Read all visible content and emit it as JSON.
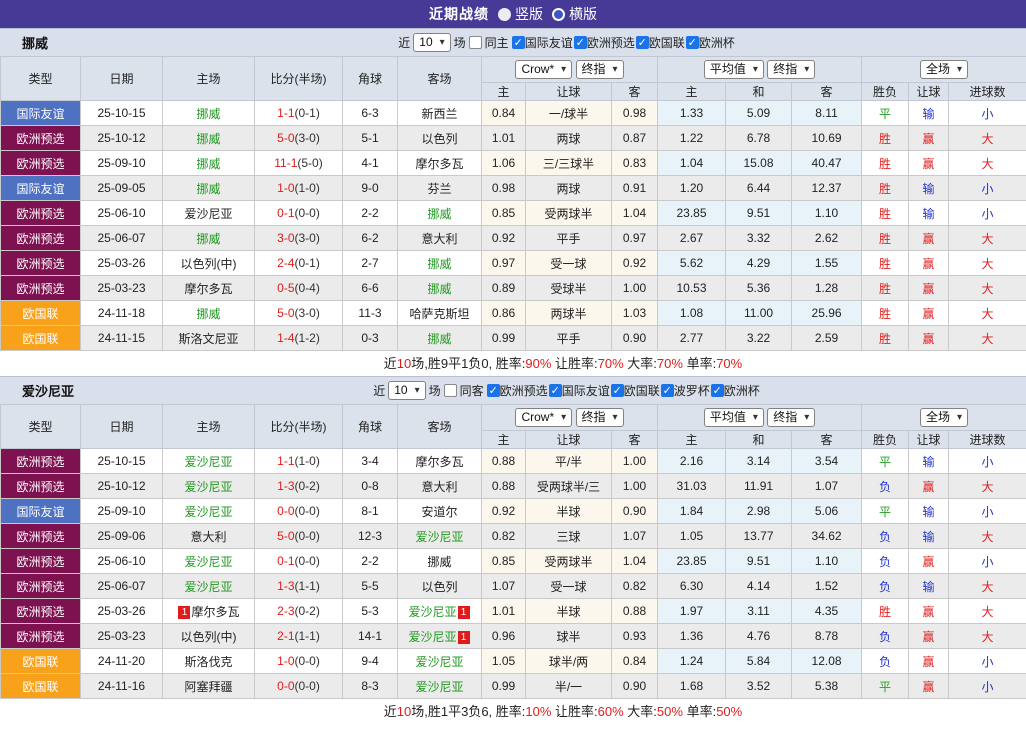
{
  "titlebar": {
    "title": "近期战绩",
    "radios": [
      {
        "label": "竖版",
        "selected": true
      },
      {
        "label": "横版",
        "selected": false
      }
    ]
  },
  "icons": {
    "check": "✓",
    "select_arrow": "▾"
  },
  "colors": {
    "accent_purple": "#473a97",
    "section_header_bg": "#d9dfeb",
    "table_header_bg": "#dce2ec",
    "row_alt_bg": "#ebebeb",
    "odds_group1_bg": "#fcf7ec",
    "odds_group2_bg": "#e7f3f8",
    "badge_friendly_blue": "#4f71c2",
    "badge_qualifier_maroon": "#7e1150",
    "badge_nations_orange": "#f8a11b",
    "team_focus_green": "#1f9a1f",
    "win_red": "#e02222",
    "lose_blue": "#2233cc",
    "draw_green": "#21a021",
    "score_red": "#e01b1b"
  },
  "table_header": {
    "left_cols": [
      "类型",
      "日期",
      "主场",
      "比分(半场)",
      "角球",
      "客场"
    ],
    "selects": {
      "crow": "Crow*",
      "final1": "终指",
      "avg": "平均值",
      "final2": "终指",
      "full": "全场"
    },
    "sub_cols": [
      "主",
      "让球",
      "客",
      "主",
      "和",
      "客",
      "胜负",
      "让球",
      "进球数"
    ]
  },
  "sections": [
    {
      "team": "挪威",
      "filter": {
        "near_label": "近",
        "count": "10",
        "matches_label": "场",
        "same_label": "同主",
        "same_checked": false,
        "competitions": [
          {
            "label": "国际友谊",
            "checked": true
          },
          {
            "label": "欧洲预选",
            "checked": true
          },
          {
            "label": "欧国联",
            "checked": true
          },
          {
            "label": "欧洲杯",
            "checked": true
          }
        ]
      },
      "rows": [
        {
          "type": "国际友谊",
          "tc": "friendly",
          "date": "25-10-15",
          "home": {
            "n": "挪威",
            "f": true,
            "r": ""
          },
          "score": "1-1",
          "half": "(0-1)",
          "corner": "6-3",
          "away": {
            "n": "新西兰",
            "f": false,
            "r": ""
          },
          "o1": [
            "0.84",
            "一/球半",
            "0.98"
          ],
          "o2": [
            "1.33",
            "5.09",
            "8.11"
          ],
          "res": [
            [
              "平",
              "green"
            ],
            [
              "输",
              "blue"
            ],
            [
              "小",
              "blue"
            ]
          ]
        },
        {
          "type": "欧洲预选",
          "tc": "qualifier",
          "date": "25-10-12",
          "home": {
            "n": "挪威",
            "f": true,
            "r": ""
          },
          "score": "5-0",
          "half": "(3-0)",
          "corner": "5-1",
          "away": {
            "n": "以色列",
            "f": false,
            "r": ""
          },
          "o1": [
            "1.01",
            "两球",
            "0.87"
          ],
          "o2": [
            "1.22",
            "6.78",
            "10.69"
          ],
          "res": [
            [
              "胜",
              "red"
            ],
            [
              "赢",
              "red"
            ],
            [
              "大",
              "red"
            ]
          ]
        },
        {
          "type": "欧洲预选",
          "tc": "qualifier",
          "date": "25-09-10",
          "home": {
            "n": "挪威",
            "f": true,
            "r": ""
          },
          "score": "11-1",
          "half": "(5-0)",
          "corner": "4-1",
          "away": {
            "n": "摩尔多瓦",
            "f": false,
            "r": ""
          },
          "o1": [
            "1.06",
            "三/三球半",
            "0.83"
          ],
          "o2": [
            "1.04",
            "15.08",
            "40.47"
          ],
          "res": [
            [
              "胜",
              "red"
            ],
            [
              "赢",
              "red"
            ],
            [
              "大",
              "red"
            ]
          ]
        },
        {
          "type": "国际友谊",
          "tc": "friendly",
          "date": "25-09-05",
          "home": {
            "n": "挪威",
            "f": true,
            "r": ""
          },
          "score": "1-0",
          "half": "(1-0)",
          "corner": "9-0",
          "away": {
            "n": "芬兰",
            "f": false,
            "r": ""
          },
          "o1": [
            "0.98",
            "两球",
            "0.91"
          ],
          "o2": [
            "1.20",
            "6.44",
            "12.37"
          ],
          "res": [
            [
              "胜",
              "red"
            ],
            [
              "输",
              "blue"
            ],
            [
              "小",
              "blue"
            ]
          ]
        },
        {
          "type": "欧洲预选",
          "tc": "qualifier",
          "date": "25-06-10",
          "home": {
            "n": "爱沙尼亚",
            "f": false,
            "r": ""
          },
          "score": "0-1",
          "half": "(0-0)",
          "corner": "2-2",
          "away": {
            "n": "挪威",
            "f": true,
            "r": ""
          },
          "o1": [
            "0.85",
            "受两球半",
            "1.04"
          ],
          "o2": [
            "23.85",
            "9.51",
            "1.10"
          ],
          "res": [
            [
              "胜",
              "red"
            ],
            [
              "输",
              "blue"
            ],
            [
              "小",
              "blue"
            ]
          ]
        },
        {
          "type": "欧洲预选",
          "tc": "qualifier",
          "date": "25-06-07",
          "home": {
            "n": "挪威",
            "f": true,
            "r": ""
          },
          "score": "3-0",
          "half": "(3-0)",
          "corner": "6-2",
          "away": {
            "n": "意大利",
            "f": false,
            "r": ""
          },
          "o1": [
            "0.92",
            "平手",
            "0.97"
          ],
          "o2": [
            "2.67",
            "3.32",
            "2.62"
          ],
          "res": [
            [
              "胜",
              "red"
            ],
            [
              "赢",
              "red"
            ],
            [
              "大",
              "red"
            ]
          ]
        },
        {
          "type": "欧洲预选",
          "tc": "qualifier",
          "date": "25-03-26",
          "home": {
            "n": "以色列(中)",
            "f": false,
            "r": ""
          },
          "score": "2-4",
          "half": "(0-1)",
          "corner": "2-7",
          "away": {
            "n": "挪威",
            "f": true,
            "r": ""
          },
          "o1": [
            "0.97",
            "受一球",
            "0.92"
          ],
          "o2": [
            "5.62",
            "4.29",
            "1.55"
          ],
          "res": [
            [
              "胜",
              "red"
            ],
            [
              "赢",
              "red"
            ],
            [
              "大",
              "red"
            ]
          ]
        },
        {
          "type": "欧洲预选",
          "tc": "qualifier",
          "date": "25-03-23",
          "home": {
            "n": "摩尔多瓦",
            "f": false,
            "r": ""
          },
          "score": "0-5",
          "half": "(0-4)",
          "corner": "6-6",
          "away": {
            "n": "挪威",
            "f": true,
            "r": ""
          },
          "o1": [
            "0.89",
            "受球半",
            "1.00"
          ],
          "o2": [
            "10.53",
            "5.36",
            "1.28"
          ],
          "res": [
            [
              "胜",
              "red"
            ],
            [
              "赢",
              "red"
            ],
            [
              "大",
              "red"
            ]
          ]
        },
        {
          "type": "欧国联",
          "tc": "nations",
          "date": "24-11-18",
          "home": {
            "n": "挪威",
            "f": true,
            "r": ""
          },
          "score": "5-0",
          "half": "(3-0)",
          "corner": "11-3",
          "away": {
            "n": "哈萨克斯坦",
            "f": false,
            "r": ""
          },
          "o1": [
            "0.86",
            "两球半",
            "1.03"
          ],
          "o2": [
            "1.08",
            "11.00",
            "25.96"
          ],
          "res": [
            [
              "胜",
              "red"
            ],
            [
              "赢",
              "red"
            ],
            [
              "大",
              "red"
            ]
          ]
        },
        {
          "type": "欧国联",
          "tc": "nations",
          "date": "24-11-15",
          "home": {
            "n": "斯洛文尼亚",
            "f": false,
            "r": ""
          },
          "score": "1-4",
          "half": "(1-2)",
          "corner": "0-3",
          "away": {
            "n": "挪威",
            "f": true,
            "r": ""
          },
          "o1": [
            "0.99",
            "平手",
            "0.90"
          ],
          "o2": [
            "2.77",
            "3.22",
            "2.59"
          ],
          "res": [
            [
              "胜",
              "red"
            ],
            [
              "赢",
              "red"
            ],
            [
              "大",
              "red"
            ]
          ]
        }
      ],
      "summary": [
        {
          "t": "近",
          "red": false
        },
        {
          "t": "10",
          "red": true
        },
        {
          "t": "场,胜9平1负0, 胜率:",
          "red": false
        },
        {
          "t": "90%",
          "red": true
        },
        {
          "t": " 让胜率:",
          "red": false
        },
        {
          "t": "70%",
          "red": true
        },
        {
          "t": " 大率:",
          "red": false
        },
        {
          "t": "70%",
          "red": true
        },
        {
          "t": " 单率:",
          "red": false
        },
        {
          "t": "70%",
          "red": true
        }
      ]
    },
    {
      "team": "爱沙尼亚",
      "filter": {
        "near_label": "近",
        "count": "10",
        "matches_label": "场",
        "same_label": "同客",
        "same_checked": false,
        "competitions": [
          {
            "label": "欧洲预选",
            "checked": true
          },
          {
            "label": "国际友谊",
            "checked": true
          },
          {
            "label": "欧国联",
            "checked": true
          },
          {
            "label": "波罗杯",
            "checked": true
          },
          {
            "label": "欧洲杯",
            "checked": true
          }
        ]
      },
      "rows": [
        {
          "type": "欧洲预选",
          "tc": "qualifier",
          "date": "25-10-15",
          "home": {
            "n": "爱沙尼亚",
            "f": true,
            "r": ""
          },
          "score": "1-1",
          "half": "(1-0)",
          "corner": "3-4",
          "away": {
            "n": "摩尔多瓦",
            "f": false,
            "r": ""
          },
          "o1": [
            "0.88",
            "平/半",
            "1.00"
          ],
          "o2": [
            "2.16",
            "3.14",
            "3.54"
          ],
          "res": [
            [
              "平",
              "green"
            ],
            [
              "输",
              "blue"
            ],
            [
              "小",
              "blue"
            ]
          ]
        },
        {
          "type": "欧洲预选",
          "tc": "qualifier",
          "date": "25-10-12",
          "home": {
            "n": "爱沙尼亚",
            "f": true,
            "r": ""
          },
          "score": "1-3",
          "half": "(0-2)",
          "corner": "0-8",
          "away": {
            "n": "意大利",
            "f": false,
            "r": ""
          },
          "o1": [
            "0.88",
            "受两球半/三",
            "1.00"
          ],
          "o2": [
            "31.03",
            "11.91",
            "1.07"
          ],
          "res": [
            [
              "负",
              "blue"
            ],
            [
              "赢",
              "red"
            ],
            [
              "大",
              "red"
            ]
          ]
        },
        {
          "type": "国际友谊",
          "tc": "friendly",
          "date": "25-09-10",
          "home": {
            "n": "爱沙尼亚",
            "f": true,
            "r": ""
          },
          "score": "0-0",
          "half": "(0-0)",
          "corner": "8-1",
          "away": {
            "n": "安道尔",
            "f": false,
            "r": ""
          },
          "o1": [
            "0.92",
            "半球",
            "0.90"
          ],
          "o2": [
            "1.84",
            "2.98",
            "5.06"
          ],
          "res": [
            [
              "平",
              "green"
            ],
            [
              "输",
              "blue"
            ],
            [
              "小",
              "blue"
            ]
          ]
        },
        {
          "type": "欧洲预选",
          "tc": "qualifier",
          "date": "25-09-06",
          "home": {
            "n": "意大利",
            "f": false,
            "r": ""
          },
          "score": "5-0",
          "half": "(0-0)",
          "corner": "12-3",
          "away": {
            "n": "爱沙尼亚",
            "f": true,
            "r": ""
          },
          "o1": [
            "0.82",
            "三球",
            "1.07"
          ],
          "o2": [
            "1.05",
            "13.77",
            "34.62"
          ],
          "res": [
            [
              "负",
              "blue"
            ],
            [
              "输",
              "blue"
            ],
            [
              "大",
              "red"
            ]
          ]
        },
        {
          "type": "欧洲预选",
          "tc": "qualifier",
          "date": "25-06-10",
          "home": {
            "n": "爱沙尼亚",
            "f": true,
            "r": ""
          },
          "score": "0-1",
          "half": "(0-0)",
          "corner": "2-2",
          "away": {
            "n": "挪威",
            "f": false,
            "r": ""
          },
          "o1": [
            "0.85",
            "受两球半",
            "1.04"
          ],
          "o2": [
            "23.85",
            "9.51",
            "1.10"
          ],
          "res": [
            [
              "负",
              "blue"
            ],
            [
              "赢",
              "red"
            ],
            [
              "小",
              "blue"
            ]
          ]
        },
        {
          "type": "欧洲预选",
          "tc": "qualifier",
          "date": "25-06-07",
          "home": {
            "n": "爱沙尼亚",
            "f": true,
            "r": ""
          },
          "score": "1-3",
          "half": "(1-1)",
          "corner": "5-5",
          "away": {
            "n": "以色列",
            "f": false,
            "r": ""
          },
          "o1": [
            "1.07",
            "受一球",
            "0.82"
          ],
          "o2": [
            "6.30",
            "4.14",
            "1.52"
          ],
          "res": [
            [
              "负",
              "blue"
            ],
            [
              "输",
              "blue"
            ],
            [
              "大",
              "red"
            ]
          ]
        },
        {
          "type": "欧洲预选",
          "tc": "qualifier",
          "date": "25-03-26",
          "home": {
            "n": "摩尔多瓦",
            "f": false,
            "r": "1"
          },
          "score": "2-3",
          "half": "(0-2)",
          "corner": "5-3",
          "away": {
            "n": "爱沙尼亚",
            "f": true,
            "r": "1"
          },
          "o1": [
            "1.01",
            "半球",
            "0.88"
          ],
          "o2": [
            "1.97",
            "3.11",
            "4.35"
          ],
          "res": [
            [
              "胜",
              "red"
            ],
            [
              "赢",
              "red"
            ],
            [
              "大",
              "red"
            ]
          ]
        },
        {
          "type": "欧洲预选",
          "tc": "qualifier",
          "date": "25-03-23",
          "home": {
            "n": "以色列(中)",
            "f": false,
            "r": ""
          },
          "score": "2-1",
          "half": "(1-1)",
          "corner": "14-1",
          "away": {
            "n": "爱沙尼亚",
            "f": true,
            "r": "1"
          },
          "o1": [
            "0.96",
            "球半",
            "0.93"
          ],
          "o2": [
            "1.36",
            "4.76",
            "8.78"
          ],
          "res": [
            [
              "负",
              "blue"
            ],
            [
              "赢",
              "red"
            ],
            [
              "大",
              "red"
            ]
          ]
        },
        {
          "type": "欧国联",
          "tc": "nations",
          "date": "24-11-20",
          "home": {
            "n": "斯洛伐克",
            "f": false,
            "r": ""
          },
          "score": "1-0",
          "half": "(0-0)",
          "corner": "9-4",
          "away": {
            "n": "爱沙尼亚",
            "f": true,
            "r": ""
          },
          "o1": [
            "1.05",
            "球半/两",
            "0.84"
          ],
          "o2": [
            "1.24",
            "5.84",
            "12.08"
          ],
          "res": [
            [
              "负",
              "blue"
            ],
            [
              "赢",
              "red"
            ],
            [
              "小",
              "blue"
            ]
          ]
        },
        {
          "type": "欧国联",
          "tc": "nations",
          "date": "24-11-16",
          "home": {
            "n": "阿塞拜疆",
            "f": false,
            "r": ""
          },
          "score": "0-0",
          "half": "(0-0)",
          "corner": "8-3",
          "away": {
            "n": "爱沙尼亚",
            "f": true,
            "r": ""
          },
          "o1": [
            "0.99",
            "半/一",
            "0.90"
          ],
          "o2": [
            "1.68",
            "3.52",
            "5.38"
          ],
          "res": [
            [
              "平",
              "green"
            ],
            [
              "赢",
              "red"
            ],
            [
              "小",
              "blue"
            ]
          ]
        }
      ],
      "summary": [
        {
          "t": "近",
          "red": false
        },
        {
          "t": "10",
          "red": true
        },
        {
          "t": "场,胜1平3负6, 胜率:",
          "red": false
        },
        {
          "t": "10%",
          "red": true
        },
        {
          "t": " 让胜率:",
          "red": false
        },
        {
          "t": "60%",
          "red": true
        },
        {
          "t": " 大率:",
          "red": false
        },
        {
          "t": "50%",
          "red": true
        },
        {
          "t": " 单率:",
          "red": false
        },
        {
          "t": "50%",
          "red": true
        }
      ]
    }
  ]
}
